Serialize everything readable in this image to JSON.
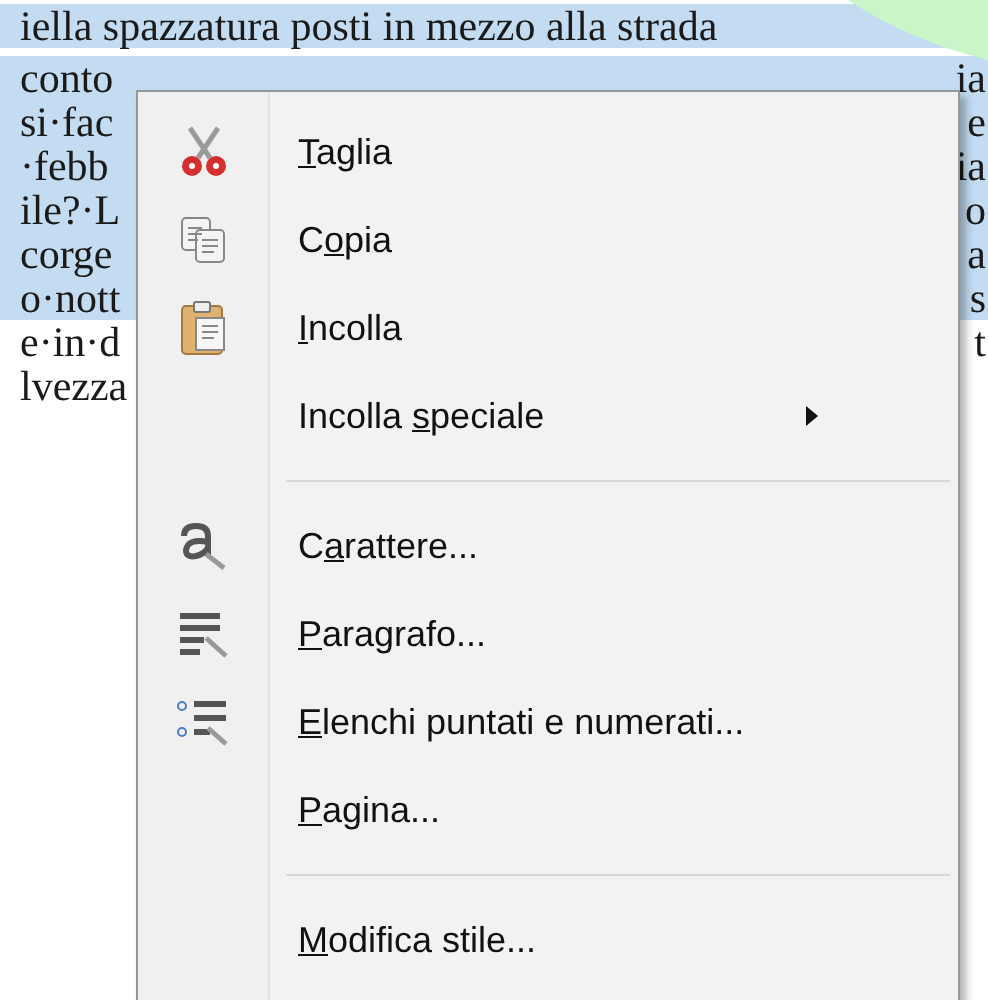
{
  "document": {
    "lines": [
      {
        "left": "iella spazzatura posti in mezzo alla strada",
        "selected": true
      },
      {
        "left": "conto",
        "right": "ia",
        "selected": true
      },
      {
        "left": "si·fac",
        "right": "e",
        "selected": true
      },
      {
        "left": "·febb",
        "right": "ia",
        "selected": true
      },
      {
        "left": "ile?·L",
        "right": "o",
        "selected": true
      },
      {
        "left": "corge",
        "right": "a",
        "selected": true
      },
      {
        "left": "o·nott",
        "right": "s",
        "selected": true
      },
      {
        "left": "e·in·d",
        "right": "t",
        "selected": false
      },
      {
        "left": "lvezza",
        "selected": false
      }
    ]
  },
  "context_menu": {
    "items": [
      {
        "kind": "item",
        "key": "T",
        "after": "aglia",
        "submenu": false
      },
      {
        "kind": "item",
        "before": "C",
        "key": "o",
        "after": "pia",
        "submenu": false
      },
      {
        "kind": "item",
        "key": "I",
        "after": "ncolla",
        "submenu": false
      },
      {
        "kind": "item",
        "before": "Incolla ",
        "key": "s",
        "after": "peciale",
        "submenu": true
      },
      {
        "kind": "separator"
      },
      {
        "kind": "item",
        "before": "C",
        "key": "a",
        "after": "rattere...",
        "submenu": false
      },
      {
        "kind": "item",
        "key": "P",
        "after": "aragrafo...",
        "submenu": false
      },
      {
        "kind": "item",
        "key": "E",
        "after": "lenchi puntati e numerati...",
        "submenu": false
      },
      {
        "kind": "item",
        "key": "P",
        "after": "agina...",
        "submenu": false
      },
      {
        "kind": "separator"
      },
      {
        "kind": "item",
        "key": "M",
        "after": "odifica stile...",
        "submenu": false
      }
    ]
  }
}
